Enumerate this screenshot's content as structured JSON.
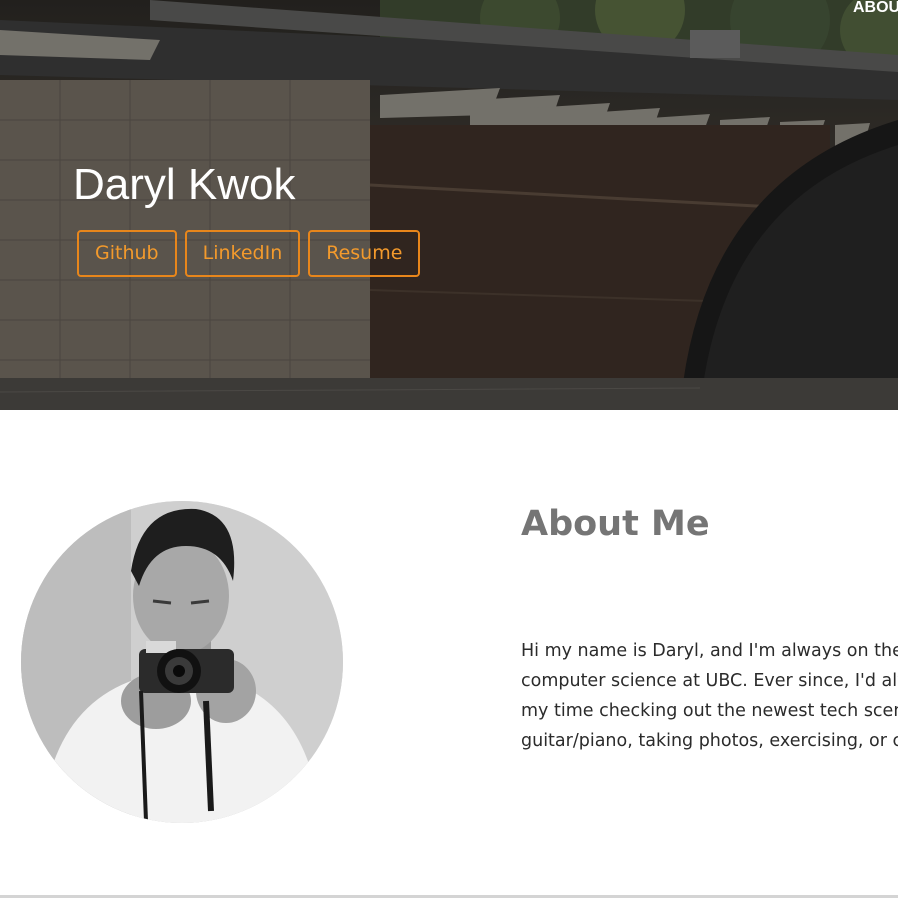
{
  "nav": {
    "about_label": "ABOUT"
  },
  "hero": {
    "name": "Daryl Kwok",
    "buttons": [
      {
        "label": "Github"
      },
      {
        "label": "LinkedIn"
      },
      {
        "label": "Resume"
      }
    ],
    "background": "photo of stone building with pergola",
    "accent_color": "#e8861b"
  },
  "about": {
    "title": "About Me",
    "photo": "black-and-white portrait holding camera",
    "lines": [
      "Hi my name is Daryl, and I'm always on the",
      "computer science at UBC. Ever since, I'd alw",
      "my time checking out the newest tech scen",
      "guitar/piano, taking photos, exercising, or c"
    ]
  }
}
